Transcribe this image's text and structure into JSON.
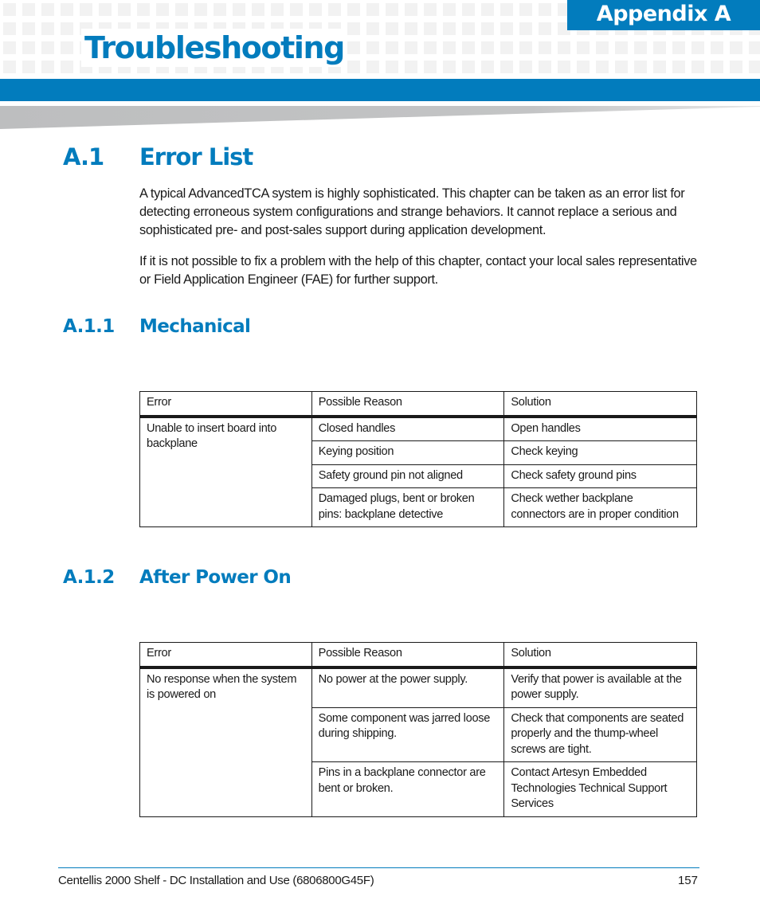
{
  "header": {
    "appendix_label": "Appendix A",
    "chapter_title": "Troubleshooting",
    "accent_color": "#027cbd"
  },
  "section": {
    "number": "A.1",
    "title": "Error List",
    "paragraphs": [
      "A typical AdvancedTCA system is highly sophisticated. This chapter can be taken as an error list for detecting erroneous system configurations and strange behaviors. It cannot replace a serious and sophisticated pre- and post-sales support during application development.",
      "If it is not possible to fix a problem with the help of this chapter, contact your local sales representative or Field Application Engineer (FAE) for further support."
    ]
  },
  "subsections": [
    {
      "number": "A.1.1",
      "title": "Mechanical",
      "table": {
        "columns": [
          "Error",
          "Possible Reason",
          "Solution"
        ],
        "error": "Unable to insert board into backplane",
        "rows": [
          {
            "reason": "Closed handles",
            "solution": "Open handles"
          },
          {
            "reason": "Keying position",
            "solution": "Check keying"
          },
          {
            "reason": "Safety ground pin not aligned",
            "solution": "Check safety ground pins"
          },
          {
            "reason": "Damaged plugs, bent or broken pins: backplane detective",
            "solution": "Check wether backplane connectors are in proper condition"
          }
        ]
      }
    },
    {
      "number": "A.1.2",
      "title": "After Power On",
      "table": {
        "columns": [
          "Error",
          "Possible Reason",
          "Solution"
        ],
        "error": "No response when the system is powered on",
        "rows": [
          {
            "reason": "No power at the power supply.",
            "solution": "Verify that power is available at the power supply."
          },
          {
            "reason": "Some component was jarred loose during shipping.",
            "solution": "Check that components are seated properly and the thump-wheel screws are tight."
          },
          {
            "reason": "Pins in a backplane connector are bent or broken.",
            "solution": "Contact Artesyn Embedded Technologies Technical Support Services"
          }
        ]
      }
    }
  ],
  "footer": {
    "document_title": "Centellis 2000 Shelf - DC Installation and Use (6806800G45F)",
    "page_number": "157"
  }
}
